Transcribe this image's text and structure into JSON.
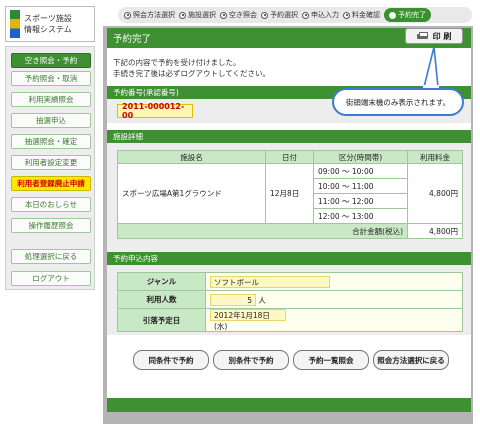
{
  "logo": {
    "line1": "スポーツ施設",
    "line2": "情報システム"
  },
  "steps": [
    {
      "label": "照会方法選択",
      "active": false
    },
    {
      "label": "施設選択",
      "active": false
    },
    {
      "label": "空き照会",
      "active": false
    },
    {
      "label": "予約選択",
      "active": false
    },
    {
      "label": "申込入力",
      "active": false
    },
    {
      "label": "料金確認",
      "active": false
    },
    {
      "label": "予約完了",
      "active": true
    }
  ],
  "sidebar": {
    "items": [
      {
        "label": "空き照会・予約",
        "style": "green"
      },
      {
        "label": "予約照会・取消",
        "style": "normal"
      },
      {
        "label": "利用実績照会",
        "style": "normal"
      },
      {
        "label": "抽選申込",
        "style": "normal"
      },
      {
        "label": "抽選照会・確定",
        "style": "normal"
      },
      {
        "label": "利用者設定変更",
        "style": "normal"
      },
      {
        "label": "利用者登録廃止申請",
        "style": "yellow"
      },
      {
        "label": "本日のおしらせ",
        "style": "normal"
      },
      {
        "label": "操作履歴照会",
        "style": "normal"
      },
      {
        "label": "処理選択に戻る",
        "style": "normal"
      },
      {
        "label": "ログアウト",
        "style": "normal"
      }
    ]
  },
  "main": {
    "title": "予約完了",
    "print_label": "印 刷",
    "intro_line1": "下記の内容で予約を受け付けました。",
    "intro_line2": "手続き完了後は必ずログアウトしてください。",
    "callout": "街頭端末機のみ表示されます。"
  },
  "reservation": {
    "section_title": "予約番号(承認番号)",
    "number": "2011-000012-00"
  },
  "facility": {
    "section_title": "施設詳細",
    "headers": [
      "施設名",
      "日付",
      "区分(時間帯)",
      "利用料金"
    ],
    "name": "スポーツ広場A第1グラウンド",
    "date": "12月8日",
    "slots": [
      "09:00 ～ 10:00",
      "10:00 ～ 11:00",
      "11:00 ～ 12:00",
      "12:00 ～ 13:00"
    ],
    "fee": "4,800円",
    "total_label": "合計金額(税込)",
    "total": "4,800円"
  },
  "details": {
    "section_title": "予約申込内容",
    "genre_label": "ジャンル",
    "genre_value": "ソフトボール",
    "people_label": "利用人数",
    "people_value": "5",
    "people_unit": "人",
    "lottery_label": "引落予定日",
    "lottery_value": "2012年1月18日(水)"
  },
  "buttons": {
    "same": "同条件で予約",
    "other": "別条件で予約",
    "list": "予約一覧照会",
    "back": "照会方法選択に戻る"
  }
}
